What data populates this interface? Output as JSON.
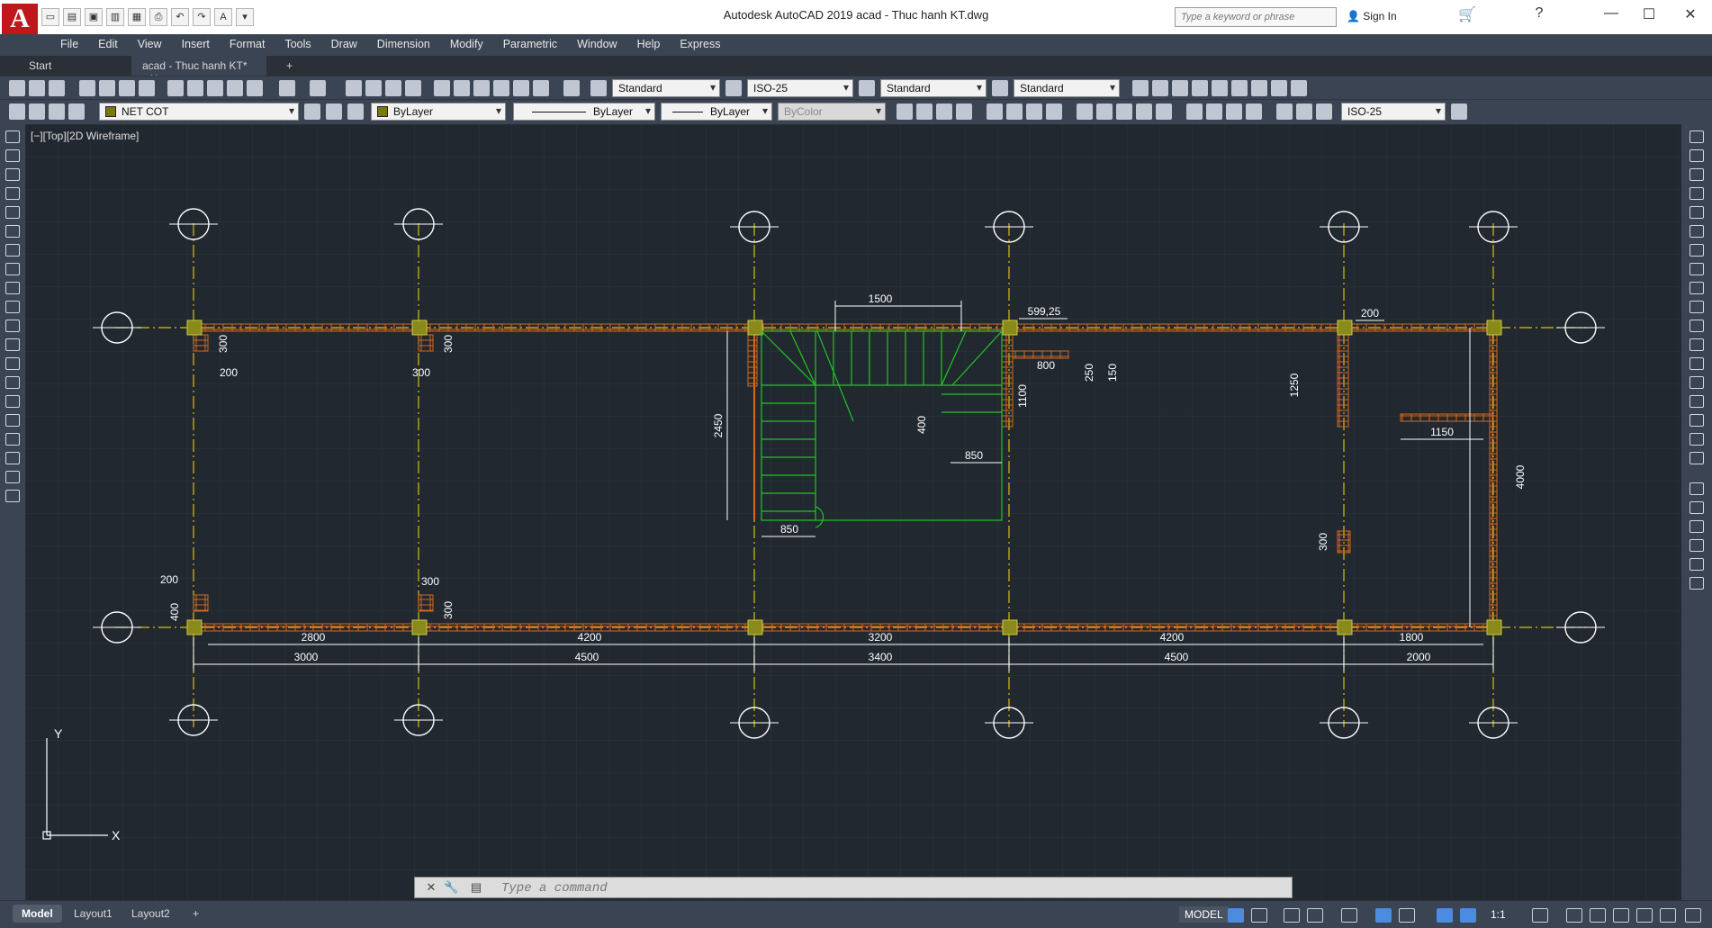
{
  "app": {
    "logo": "A",
    "title": "Autodesk AutoCAD 2019      acad - Thuc hanh KT.dwg",
    "search_placeholder": "Type a keyword or phrase",
    "signin": "Sign In"
  },
  "menu": [
    "File",
    "Edit",
    "View",
    "Insert",
    "Format",
    "Tools",
    "Draw",
    "Dimension",
    "Modify",
    "Parametric",
    "Window",
    "Help",
    "Express"
  ],
  "tabs": {
    "start": "Start",
    "doc": "acad - Thuc hanh KT*",
    "new": "+"
  },
  "toolbar1": {
    "text_style": "Standard",
    "dim_style": "ISO-25",
    "table_style": "Standard",
    "mleader_style": "Standard"
  },
  "toolbar2": {
    "layer": "NET COT",
    "color": "ByLayer",
    "linetype": "ByLayer",
    "lineweight": "ByLayer",
    "plotstyle": "ByColor",
    "dim_style2": "ISO-25"
  },
  "viewport": {
    "label": "[−][Top][2D Wireframe]"
  },
  "drawing": {
    "colors": {
      "background": "#212830",
      "grid": "#2e3640",
      "axis": "#d6c200",
      "wall": "#d2691e",
      "column": "#8a8a1a",
      "stair": "#22c422",
      "dim": "#ffffff",
      "bubble": "#ffffff"
    },
    "top_dims": [
      "1500",
      "599,25",
      "200"
    ],
    "inner_dims": [
      "300",
      "200",
      "300",
      "300",
      "2450",
      "400",
      "850",
      "850",
      "1100",
      "800",
      "250",
      "150",
      "1250",
      "1150",
      "300",
      "4000",
      "200",
      "400",
      "300",
      "300"
    ],
    "bottom_dims_row1": [
      "2800",
      "4200",
      "3200",
      "4200",
      "1800"
    ],
    "bottom_dims_row2": [
      "3000",
      "4500",
      "3400",
      "4500",
      "2000"
    ],
    "ucs": {
      "x": "X",
      "y": "Y"
    }
  },
  "command": {
    "placeholder": "Type  a  command"
  },
  "layouts": [
    "Model",
    "Layout1",
    "Layout2",
    "+"
  ],
  "status": {
    "model": "MODEL",
    "scale": "1:1"
  }
}
